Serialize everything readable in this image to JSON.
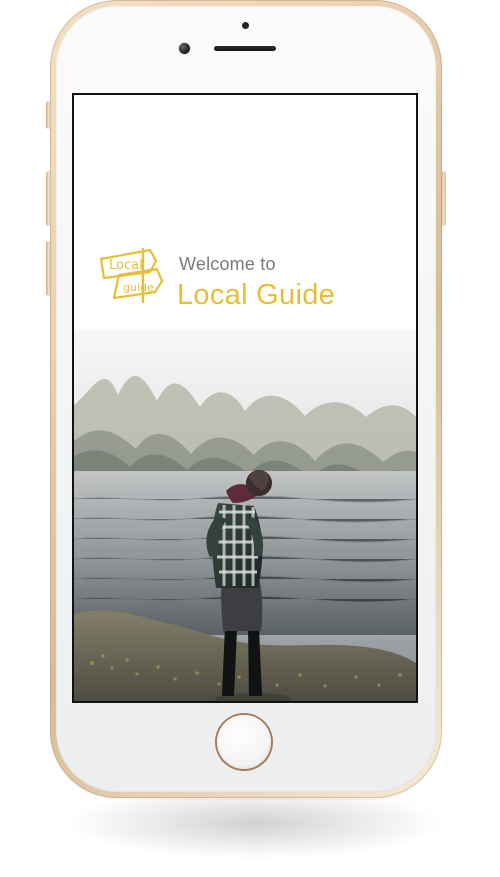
{
  "screen": {
    "welcome_line": "Welcome to",
    "app_name": "Local Guide",
    "logo": {
      "line1": "Local",
      "line2": "guide"
    }
  },
  "colors": {
    "accent": "#e5bf35",
    "muted_text": "#7a7a7a",
    "phone_gold": "#e7ccaa",
    "screen_bezel": "#101214"
  },
  "icons": {
    "logo": "signpost-logo",
    "hardware_camera": "camera-icon",
    "home": "home-button"
  }
}
